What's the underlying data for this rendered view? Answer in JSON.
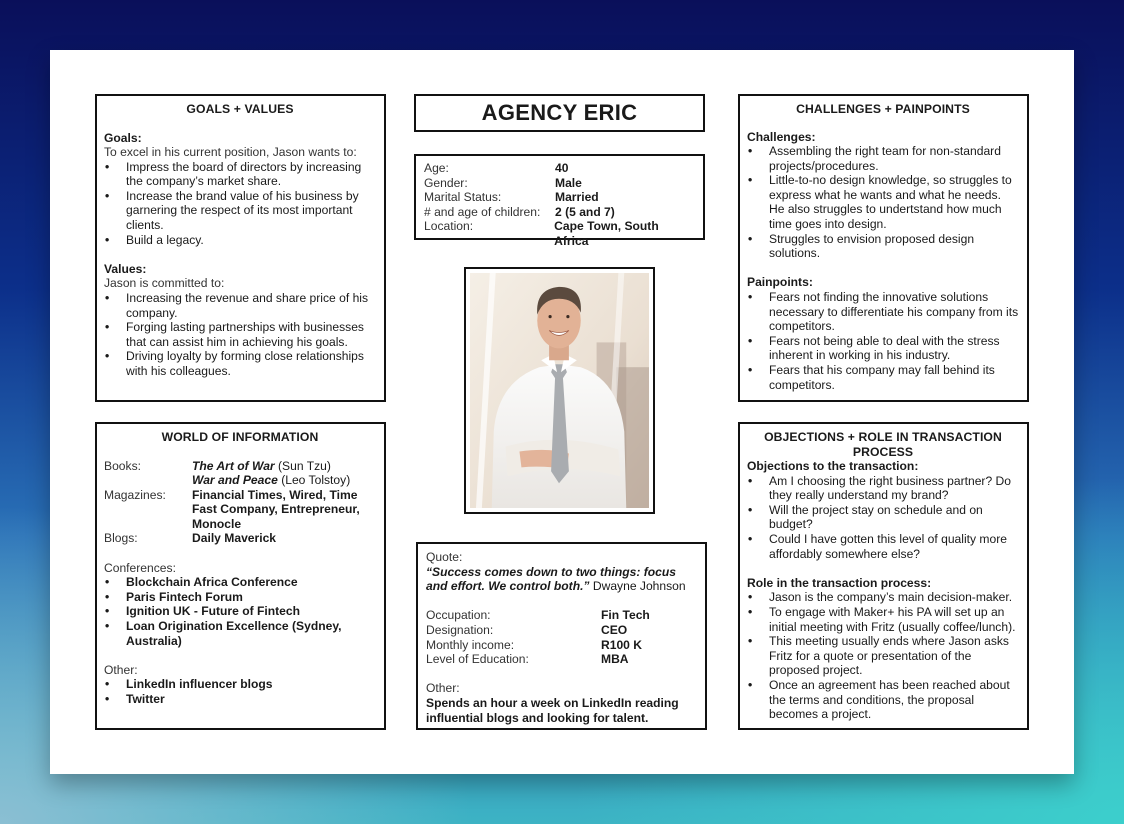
{
  "persona_name": "AGENCY ERIC",
  "goals_values": {
    "title": "GOALS + VALUES",
    "goals_heading": "Goals:",
    "goals_intro": "To excel in his current position, Jason wants to:",
    "goals": [
      "Impress the board of directors by increasing the company’s market share.",
      "Increase the brand value of his business by garnering the respect of its most important clients.",
      "Build a legacy."
    ],
    "values_heading": "Values:",
    "values_intro": "Jason is committed to:",
    "values": [
      "Increasing the revenue and share price of his company.",
      "Forging lasting partnerships with businesses that can assist him in achieving his goals.",
      "Driving loyalty by forming close relationships with his colleagues."
    ]
  },
  "demographics": [
    {
      "label": "Age:",
      "value": "40"
    },
    {
      "label": "Gender:",
      "value": "Male"
    },
    {
      "label": "Marital Status:",
      "value": "Married"
    },
    {
      "label": "# and age of children:",
      "value": "2 (5 and 7)"
    },
    {
      "label": "Location:",
      "value": "Cape Town, South Africa"
    }
  ],
  "photo": {
    "icon": "persona-photo-icon",
    "description": "Smiling man in white shirt and grey tie, arms crossed"
  },
  "challenges_painpoints": {
    "title": "CHALLENGES + PAINPOINTS",
    "challenges_heading": "Challenges:",
    "challenges": [
      "Assembling the right team for non-standard projects/procedures.",
      "Little-to-no design knowledge, so struggles to express what he wants and what he needs. He also struggles to undertstand how much time goes into design.",
      "Struggles to envision proposed design solutions."
    ],
    "painpoints_heading": "Painpoints:",
    "painpoints": [
      "Fears not finding the innovative solutions necessary to differentiate his company from its competitors.",
      "Fears not being able to deal with the stress inherent in working in his industry.",
      "Fears that his company may fall behind its competitors."
    ]
  },
  "world_of_information": {
    "title": "WORLD OF INFORMATION",
    "books_label": "Books:",
    "books": [
      {
        "title": "The Art of War",
        "author": "(Sun Tzu)"
      },
      {
        "title": "War and Peace",
        "author": "(Leo Tolstoy)"
      }
    ],
    "magazines_label": "Magazines:",
    "magazines": "Financial Times, Wired, Time Fast Company, Entrepreneur, Monocle",
    "blogs_label": "Blogs:",
    "blogs": "Daily Maverick",
    "conferences_label": "Conferences:",
    "conferences": [
      "Blockchain Africa Conference",
      "Paris Fintech Forum",
      "Ignition UK - Future of Fintech",
      "Loan Origination Excellence (Sydney, Australia)"
    ],
    "other_label": "Other:",
    "other": [
      "LinkedIn influencer blogs",
      "Twitter"
    ]
  },
  "quote_box": {
    "quote_label": "Quote:",
    "quote": "“Success comes down to two things: focus and effort. We control both.”",
    "quote_author": "Dwayne Johnson",
    "details": [
      {
        "label": "Occupation:",
        "value": "Fin Tech"
      },
      {
        "label": "Designation:",
        "value": "CEO"
      },
      {
        "label": "Monthly income:",
        "value": "R100 K"
      },
      {
        "label": "Level of Education:",
        "value": "MBA"
      }
    ],
    "other_label": "Other:",
    "other": "Spends an hour a week on LinkedIn reading influential blogs and looking for talent."
  },
  "objections_role": {
    "title": "OBJECTIONS + ROLE IN TRANSACTION PROCESS",
    "objections_heading": "Objections to the transaction:",
    "objections": [
      "Am I choosing the right business partner? Do they really understand my brand?",
      "Will the project stay on schedule and on budget?",
      "Could I have gotten this level of quality more affordably somewhere else?"
    ],
    "role_heading": "Role in the transaction process:",
    "role": [
      "Jason is the company’s main decision-maker.",
      "To engage with Maker+ his PA will set up an initial meeting with Fritz (usually coffee/lunch).",
      "This meeting usually ends where Jason asks Fritz for a quote or presentation of the proposed project.",
      "Once an agreement has been reached about the terms and conditions, the proposal becomes a project."
    ]
  }
}
